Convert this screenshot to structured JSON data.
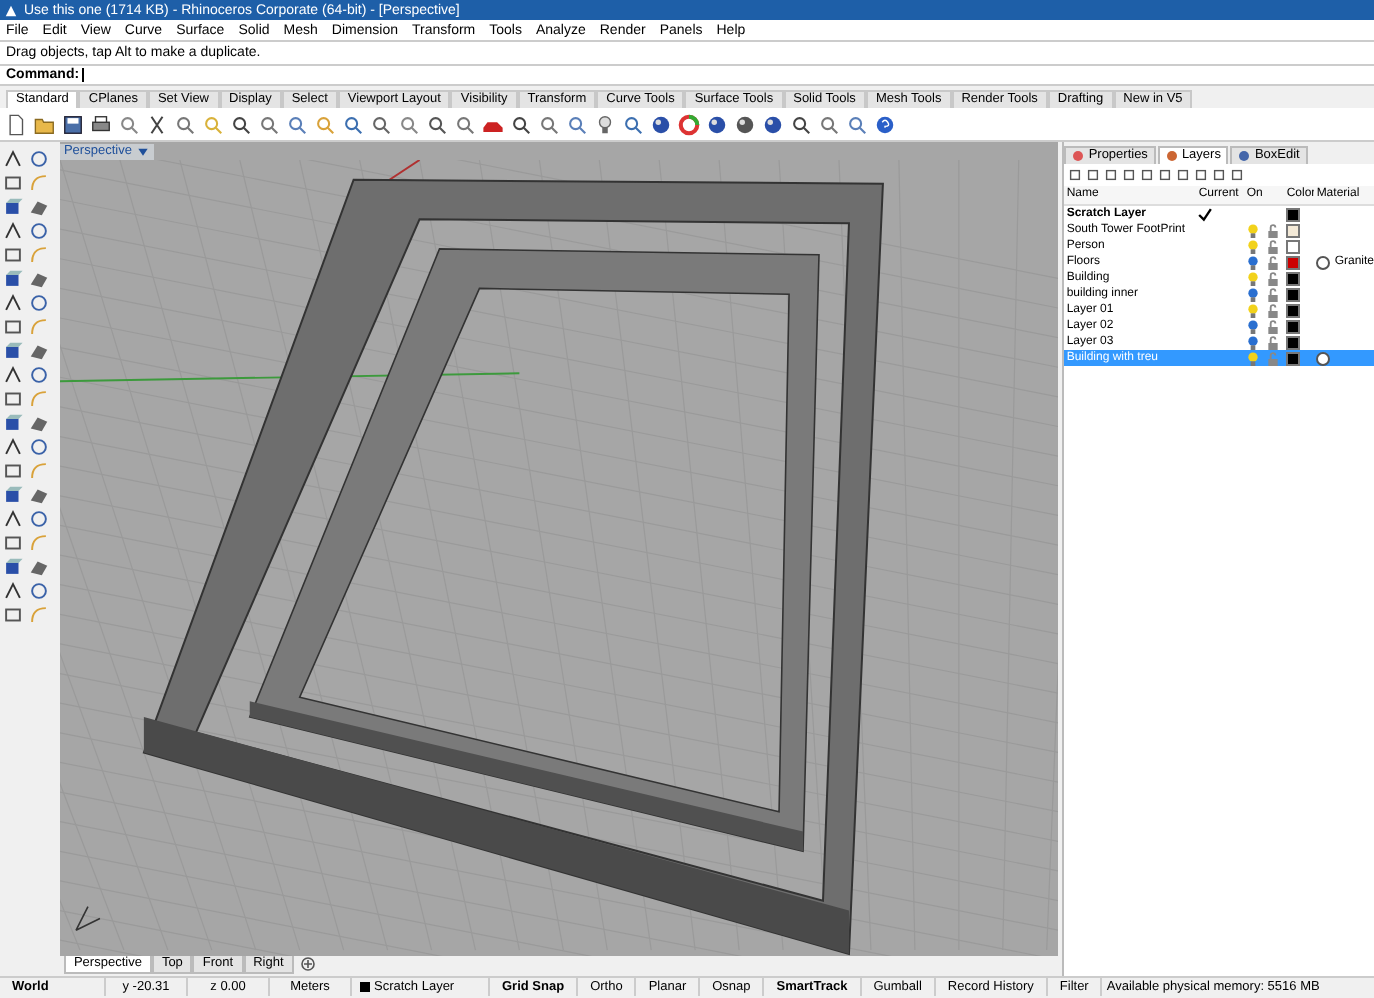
{
  "window": {
    "title": "Use this one (1714 KB) - Rhinoceros Corporate (64-bit) - [Perspective]"
  },
  "menu": [
    "File",
    "Edit",
    "View",
    "Curve",
    "Surface",
    "Solid",
    "Mesh",
    "Dimension",
    "Transform",
    "Tools",
    "Analyze",
    "Render",
    "Panels",
    "Help"
  ],
  "command_history": "Drag objects, tap Alt to make a duplicate.",
  "command": {
    "label": "Command:"
  },
  "toolbar_tabs": [
    {
      "label": "Standard",
      "selected": true
    },
    {
      "label": "CPlanes",
      "selected": false
    },
    {
      "label": "Set View",
      "selected": false
    },
    {
      "label": "Display",
      "selected": false
    },
    {
      "label": "Select",
      "selected": false
    },
    {
      "label": "Viewport Layout",
      "selected": false
    },
    {
      "label": "Visibility",
      "selected": false
    },
    {
      "label": "Transform",
      "selected": false
    },
    {
      "label": "Curve Tools",
      "selected": false
    },
    {
      "label": "Surface Tools",
      "selected": false
    },
    {
      "label": "Solid Tools",
      "selected": false
    },
    {
      "label": "Mesh Tools",
      "selected": false
    },
    {
      "label": "Render Tools",
      "selected": false
    },
    {
      "label": "Drafting",
      "selected": false
    },
    {
      "label": "New in V5",
      "selected": false
    }
  ],
  "viewport": {
    "title": "Perspective",
    "tabs": [
      {
        "label": "Perspective",
        "selected": true
      },
      {
        "label": "Top",
        "selected": false
      },
      {
        "label": "Front",
        "selected": false
      },
      {
        "label": "Right",
        "selected": false
      }
    ]
  },
  "panel": {
    "tabs": [
      {
        "label": "Properties",
        "selected": false
      },
      {
        "label": "Layers",
        "selected": true
      },
      {
        "label": "BoxEdit",
        "selected": false
      }
    ],
    "columns": [
      "Name",
      "Current",
      "On",
      "Color",
      "Material"
    ],
    "layers": [
      {
        "name": "Scratch Layer",
        "kind": "scratch",
        "current": true,
        "color": "#000000",
        "has_material": false,
        "selected": false
      },
      {
        "name": "South Tower FootPrint",
        "kind": "layer",
        "current": false,
        "on": true,
        "color": "#f4ead8",
        "has_material": false,
        "selected": false
      },
      {
        "name": "Person",
        "kind": "layer",
        "current": false,
        "on": true,
        "color": "#ffffff",
        "has_material": false,
        "selected": false
      },
      {
        "name": "Floors",
        "kind": "layer",
        "current": false,
        "on": false,
        "color": "#cc0000",
        "has_material": true,
        "material_name": "Granite",
        "selected": false
      },
      {
        "name": "Building",
        "kind": "layer",
        "current": false,
        "on": true,
        "color": "#000000",
        "has_material": false,
        "selected": false
      },
      {
        "name": "building inner",
        "kind": "layer",
        "current": false,
        "on": false,
        "color": "#000000",
        "has_material": false,
        "selected": false
      },
      {
        "name": "Layer 01",
        "kind": "layer",
        "current": false,
        "on": true,
        "color": "#000000",
        "has_material": false,
        "selected": false
      },
      {
        "name": "Layer 02",
        "kind": "layer",
        "current": false,
        "on": false,
        "color": "#000000",
        "has_material": false,
        "selected": false
      },
      {
        "name": "Layer 03",
        "kind": "layer",
        "current": false,
        "on": false,
        "color": "#000000",
        "has_material": false,
        "selected": false
      },
      {
        "name": "Building with treu",
        "kind": "layer",
        "current": false,
        "on": true,
        "color": "#000000",
        "has_material": true,
        "selected": true
      }
    ]
  },
  "status_bar": [
    {
      "kind": "label",
      "text": "World"
    },
    {
      "kind": "coord",
      "text": "y -20.31"
    },
    {
      "kind": "coord",
      "text": "z 0.00"
    },
    {
      "kind": "coord",
      "text": "Meters"
    },
    {
      "kind": "layer",
      "text": "Scratch Layer",
      "color": "#000000"
    },
    {
      "kind": "toggle",
      "text": "Grid Snap",
      "on": true
    },
    {
      "kind": "toggle",
      "text": "Ortho",
      "on": false
    },
    {
      "kind": "toggle",
      "text": "Planar",
      "on": false
    },
    {
      "kind": "toggle",
      "text": "Osnap",
      "on": false
    },
    {
      "kind": "toggle",
      "text": "SmartTrack",
      "on": true
    },
    {
      "kind": "toggle",
      "text": "Gumball",
      "on": false
    },
    {
      "kind": "toggle",
      "text": "Record History",
      "on": false
    },
    {
      "kind": "toggle",
      "text": "Filter",
      "on": false
    },
    {
      "kind": "memo",
      "text": "Available physical memory: 5516 MB"
    }
  ]
}
